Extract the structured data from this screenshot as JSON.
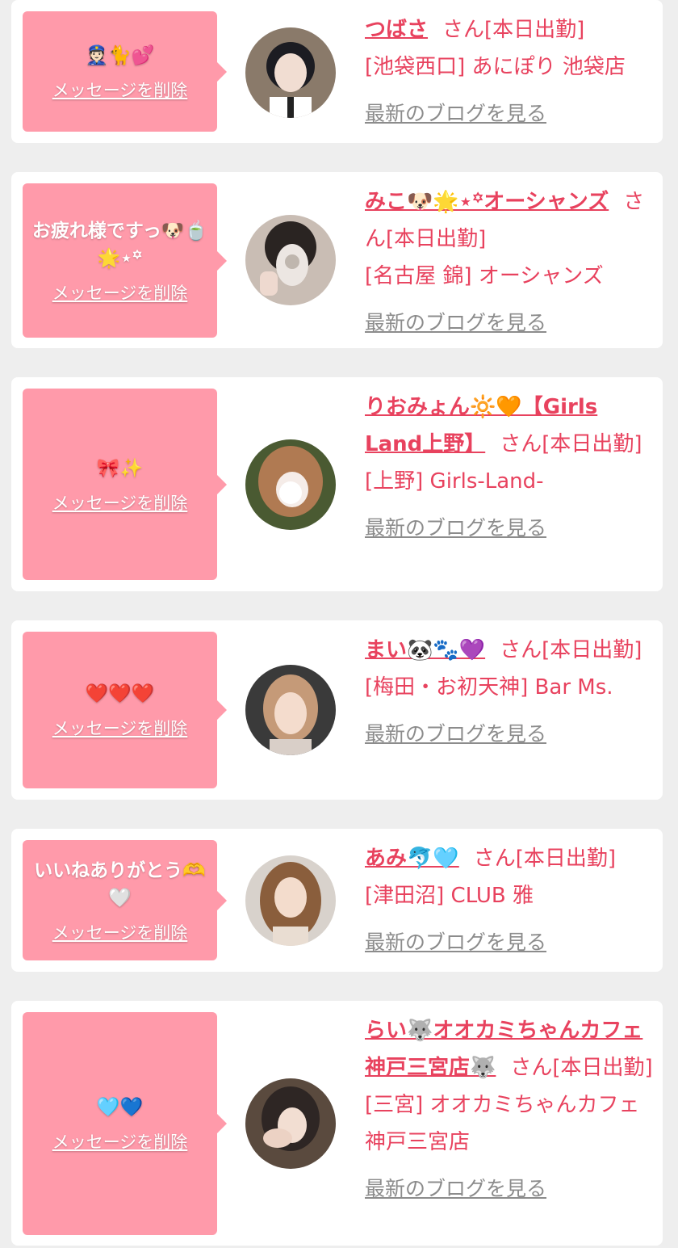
{
  "common": {
    "delete_label": "メッセージを削除",
    "blog_label": "最新のブログを見る"
  },
  "colors": {
    "accent": "#e8425e",
    "bubble": "#ff9aaa",
    "link_gray": "#8c8c8c",
    "background": "#eeeeee"
  },
  "items": [
    {
      "message": "👮🏻🐈💕",
      "name": "つばさ",
      "suffix": "さん[本日出勤]",
      "shop": "[池袋西口] あにぽり 池袋店"
    },
    {
      "message": "お疲れ様ですっ🐶🍵🌟⋆꙳",
      "name": "みこ🐶🌟⋆꙳オーシャンズ",
      "suffix": "さん[本日出勤]",
      "shop": "[名古屋 錦] オーシャンズ"
    },
    {
      "message": "🎀✨",
      "name": "りおみょん🔆🧡【Girls Land上野】",
      "suffix": "さん[本日出勤]",
      "shop": "[上野] Girls-Land-"
    },
    {
      "message": "❤️❤️❤️",
      "name": "まい🐼🐾💜",
      "suffix": "さん[本日出勤]",
      "shop": "[梅田・お初天神] Bar Ms."
    },
    {
      "message": "いいねありがとう🫶🤍",
      "name": "あみ🐬🩵",
      "suffix": "さん[本日出勤]",
      "shop": "[津田沼] CLUB 雅"
    },
    {
      "message": "🩵💙",
      "name": "らい🐺オオカミちゃんカフェ神戸三宮店🐺",
      "suffix": "さん[本日出勤]",
      "shop": "[三宮] オオカミちゃんカフェ神戸三宮店"
    }
  ]
}
